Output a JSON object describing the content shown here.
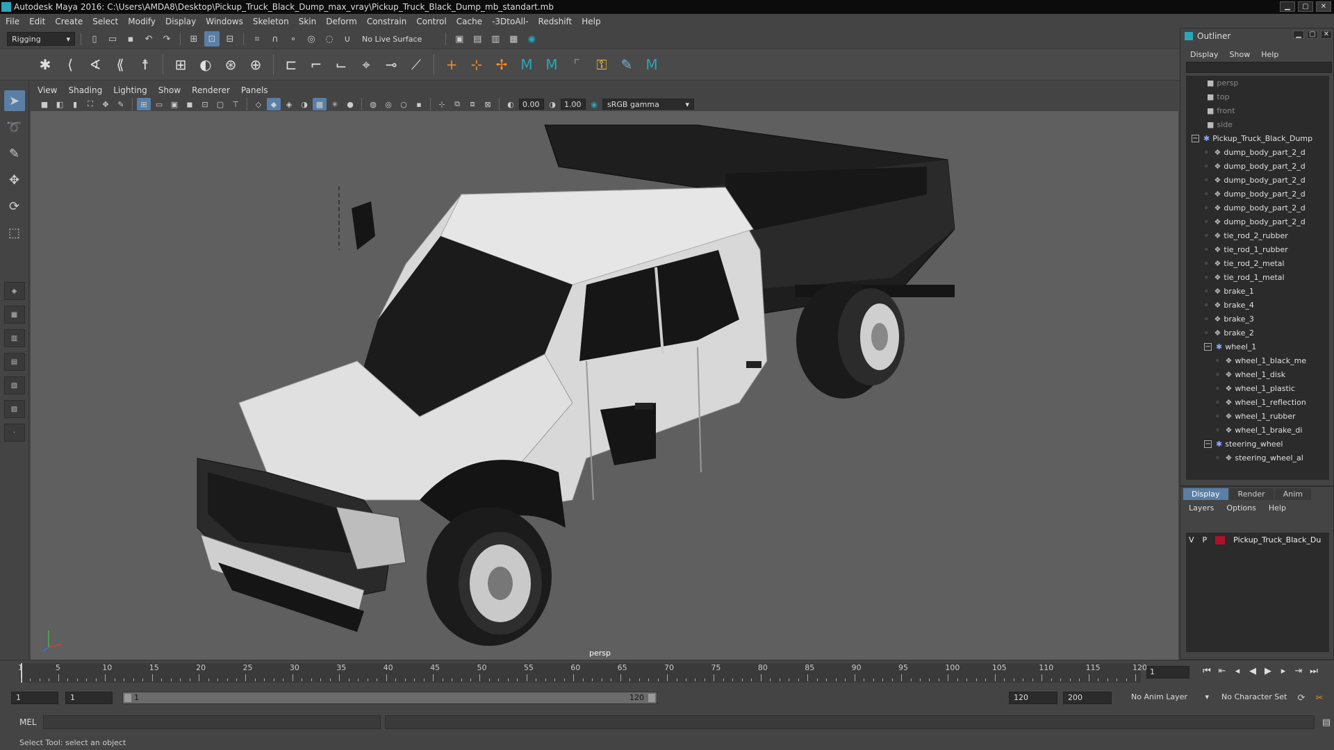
{
  "window": {
    "title": "Autodesk Maya 2016: C:\\Users\\AMDA8\\Desktop\\Pickup_Truck_Black_Dump_max_vray\\Pickup_Truck_Black_Dump_mb_standart.mb"
  },
  "menubar": [
    "File",
    "Edit",
    "Create",
    "Select",
    "Modify",
    "Display",
    "Windows",
    "Skeleton",
    "Skin",
    "Deform",
    "Constrain",
    "Control",
    "Cache",
    "-3DtoAll-",
    "Redshift",
    "Help"
  ],
  "statusline": {
    "menuset": "Rigging",
    "live_surface": "No Live Surface"
  },
  "panel": {
    "menu": [
      "View",
      "Shading",
      "Lighting",
      "Show",
      "Renderer",
      "Panels"
    ],
    "exposure": "0.00",
    "gamma": "1.00",
    "color_space": "sRGB gamma",
    "camera": "persp"
  },
  "outliner": {
    "title": "Outliner",
    "menu": [
      "Display",
      "Show",
      "Help"
    ],
    "items": [
      {
        "label": "persp",
        "type": "camera",
        "indent": 0
      },
      {
        "label": "top",
        "type": "camera",
        "indent": 0
      },
      {
        "label": "front",
        "type": "camera",
        "indent": 0
      },
      {
        "label": "side",
        "type": "camera",
        "indent": 0
      },
      {
        "label": "Pickup_Truck_Black_Dump",
        "type": "group",
        "indent": 0,
        "expand": "−"
      },
      {
        "label": "dump_body_part_2_d",
        "type": "mesh",
        "indent": 1
      },
      {
        "label": "dump_body_part_2_d",
        "type": "mesh",
        "indent": 1
      },
      {
        "label": "dump_body_part_2_d",
        "type": "mesh",
        "indent": 1
      },
      {
        "label": "dump_body_part_2_d",
        "type": "mesh",
        "indent": 1
      },
      {
        "label": "dump_body_part_2_d",
        "type": "mesh",
        "indent": 1
      },
      {
        "label": "dump_body_part_2_d",
        "type": "mesh",
        "indent": 1
      },
      {
        "label": "tie_rod_2_rubber",
        "type": "mesh",
        "indent": 1
      },
      {
        "label": "tie_rod_1_rubber",
        "type": "mesh",
        "indent": 1
      },
      {
        "label": "tie_rod_2_metal",
        "type": "mesh",
        "indent": 1
      },
      {
        "label": "tie_rod_1_metal",
        "type": "mesh",
        "indent": 1
      },
      {
        "label": "brake_1",
        "type": "mesh",
        "indent": 1
      },
      {
        "label": "brake_4",
        "type": "mesh",
        "indent": 1
      },
      {
        "label": "brake_3",
        "type": "mesh",
        "indent": 1
      },
      {
        "label": "brake_2",
        "type": "mesh",
        "indent": 1
      },
      {
        "label": "wheel_1",
        "type": "group",
        "indent": 1,
        "expand": "−"
      },
      {
        "label": "wheel_1_black_me",
        "type": "mesh",
        "indent": 2
      },
      {
        "label": "wheel_1_disk",
        "type": "mesh",
        "indent": 2
      },
      {
        "label": "wheel_1_plastic",
        "type": "mesh",
        "indent": 2
      },
      {
        "label": "wheel_1_reflection",
        "type": "mesh",
        "indent": 2
      },
      {
        "label": "wheel_1_rubber",
        "type": "mesh",
        "indent": 2
      },
      {
        "label": "wheel_1_brake_di",
        "type": "mesh",
        "indent": 2
      },
      {
        "label": "steering_wheel",
        "type": "group",
        "indent": 1,
        "expand": "−"
      },
      {
        "label": "steering_wheel_al",
        "type": "mesh",
        "indent": 2
      }
    ]
  },
  "channelbox": {
    "tabs": [
      "Display",
      "Render",
      "Anim"
    ],
    "menu": [
      "Layers",
      "Options",
      "Help"
    ],
    "layer": {
      "v": "V",
      "p": "P",
      "name": "Pickup_Truck_Black_Du",
      "color": "#b0102a"
    }
  },
  "timeline": {
    "start": 1,
    "end": 120,
    "labels": [
      "1",
      "5",
      "10",
      "15",
      "20",
      "25",
      "30",
      "35",
      "40",
      "45",
      "50",
      "55",
      "60",
      "65",
      "70",
      "75",
      "80",
      "85",
      "90",
      "95",
      "100",
      "105",
      "110",
      "115",
      "120"
    ],
    "current": "1"
  },
  "range": {
    "start": "1",
    "inner_start": "1",
    "bar_start": "1",
    "bar_end": "120",
    "end": "120",
    "outer_end": "200",
    "anim_layer": "No Anim Layer",
    "char_set": "No Character Set"
  },
  "cmdline": {
    "label": "MEL"
  },
  "helpline": {
    "text": "Select Tool: select an object"
  }
}
